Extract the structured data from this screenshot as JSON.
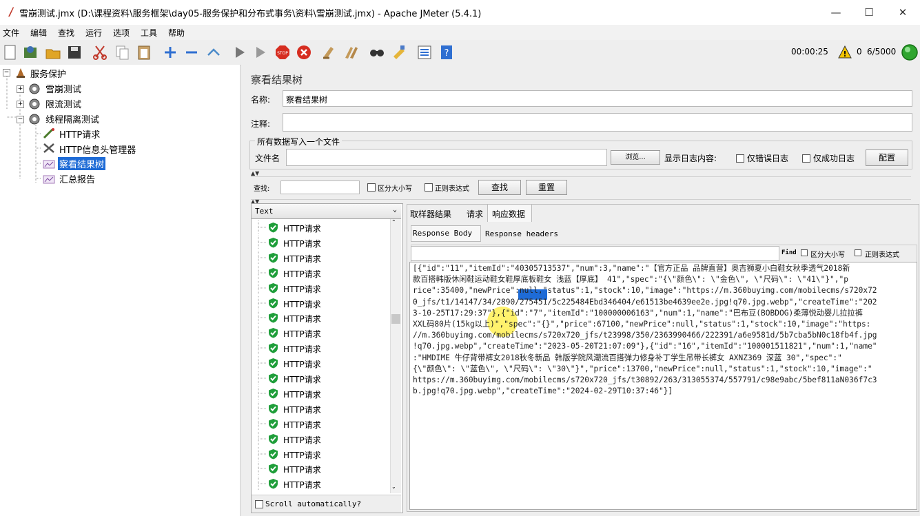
{
  "window": {
    "title": "雪崩测试.jmx (D:\\课程资料\\服务框架\\day05-服务保护和分布式事务\\资料\\雪崩测试.jmx) - Apache JMeter (5.4.1)",
    "minimize": "—",
    "maximize": "☐",
    "close": "✕"
  },
  "menu": [
    "文件",
    "编辑",
    "查找",
    "运行",
    "选项",
    "工具",
    "帮助"
  ],
  "toolbar": {
    "timer": "00:00:25",
    "warning_count": "0",
    "threads": "6/5000",
    "icons": [
      "new-icon",
      "templates-icon",
      "open-icon",
      "save-icon",
      "cut-icon",
      "copy-icon",
      "paste-icon",
      "expand-icon",
      "collapse-icon",
      "toggle-icon",
      "start-icon",
      "start-no-pause-icon",
      "stop-icon",
      "shutdown-icon",
      "clear-icon",
      "clear-all-icon",
      "search-icon",
      "reset-search-icon",
      "function-helper-icon",
      "help-icon"
    ]
  },
  "tree": {
    "root": "服务保护",
    "groups": [
      "雪崩测试",
      "限流测试",
      "线程隔离测试"
    ],
    "children": [
      "HTTP请求",
      "HTTP信息头管理器",
      "察看结果树",
      "汇总报告"
    ]
  },
  "panel": {
    "heading": "察看结果树",
    "name_label": "名称:",
    "name_value": "察看结果树",
    "comment_label": "注释:",
    "comment_value": "",
    "file_group_title": "所有数据写入一个文件",
    "filename_label": "文件名",
    "browse": "浏览...",
    "log_content_label": "显示日志内容:",
    "errors_only": "仅错误日志",
    "success_only": "仅成功日志",
    "configure": "配置"
  },
  "search": {
    "label": "查找:",
    "case_sensitive": "区分大小写",
    "regex": "正则表达式",
    "find_button": "查找",
    "reset_button": "重置"
  },
  "results": {
    "renderer": "Text",
    "sample_label": "HTTP请求",
    "scroll_auto": "Scroll automatically?"
  },
  "tabs": [
    "取样器结果",
    "请求",
    "响应数据"
  ],
  "subtabs": [
    "Response Body",
    "Response headers"
  ],
  "find_bar": {
    "label": "Find",
    "case_sensitive": "区分大小写",
    "regex": "正则表达式"
  },
  "response_lines": [
    "[{\"id\":\"11\",\"itemId\":\"40305713537\",\"num\":3,\"name\":\"【官方正品 品牌直营】奥吉狮夏小白鞋女秋季透气2018新",
    "款百搭韩版休闲鞋运动鞋女鞋厚底板鞋女 浅蓝【厚底】 41\",\"spec\":\"{\\\"颜色\\\": \\\"金色\\\", \\\"尺码\\\": \\\"41\\\"}\",\"p",
    "rice\":35400,\"newPrice\":null,\"status\":1,\"stock\":10,\"image\":\"https://m.360buyimg.com/mobilecms/s720x72",
    "0_jfs/t1/14147/34/2890/275451/5c225484Ebd346404/e61513be4639ee2e.jpg!q70.jpg.webp\",\"createTime\":\"202",
    "3-10-25T17:29:37\"},{\"id\":\"7\",\"itemId\":\"100000006163\",\"num\":1,\"name\":\"巴布豆(BOBDOG)柔薄悦动婴儿拉拉裤",
    "XXL码80片(15kg以上)\",\"spec\":\"{}\",\"price\":67100,\"newPrice\":null,\"status\":1,\"stock\":10,\"image\":\"https:",
    "//m.360buyimg.com/mobilecms/s720x720_jfs/t23998/350/2363990466/222391/a6e9581d/5b7cba5bN0c18fb4f.jpg",
    "!q70.jpg.webp\",\"createTime\":\"2023-05-20T21:07:09\"},{\"id\":\"16\",\"itemId\":\"100001511821\",\"num\":1,\"name\"",
    ":\"HMDIME 牛仔背带裤女2018秋冬新品 韩版学院风潮流百搭弹力修身补丁学生吊带长裤女 AXNZ369 深蓝 30\",\"spec\":\"",
    "{\\\"颜色\\\": \\\"蓝色\\\", \\\"尺码\\\": \\\"30\\\"}\",\"price\":13700,\"newPrice\":null,\"status\":1,\"stock\":10,\"image\":\"",
    "https://m.360buyimg.com/mobilecms/s720x720_jfs/t30892/263/313055374/557791/c98e9abc/5bef811aN036f7c3",
    "b.jpg!q70.jpg.webp\",\"createTime\":\"2024-02-29T10:37:46\"}]"
  ]
}
